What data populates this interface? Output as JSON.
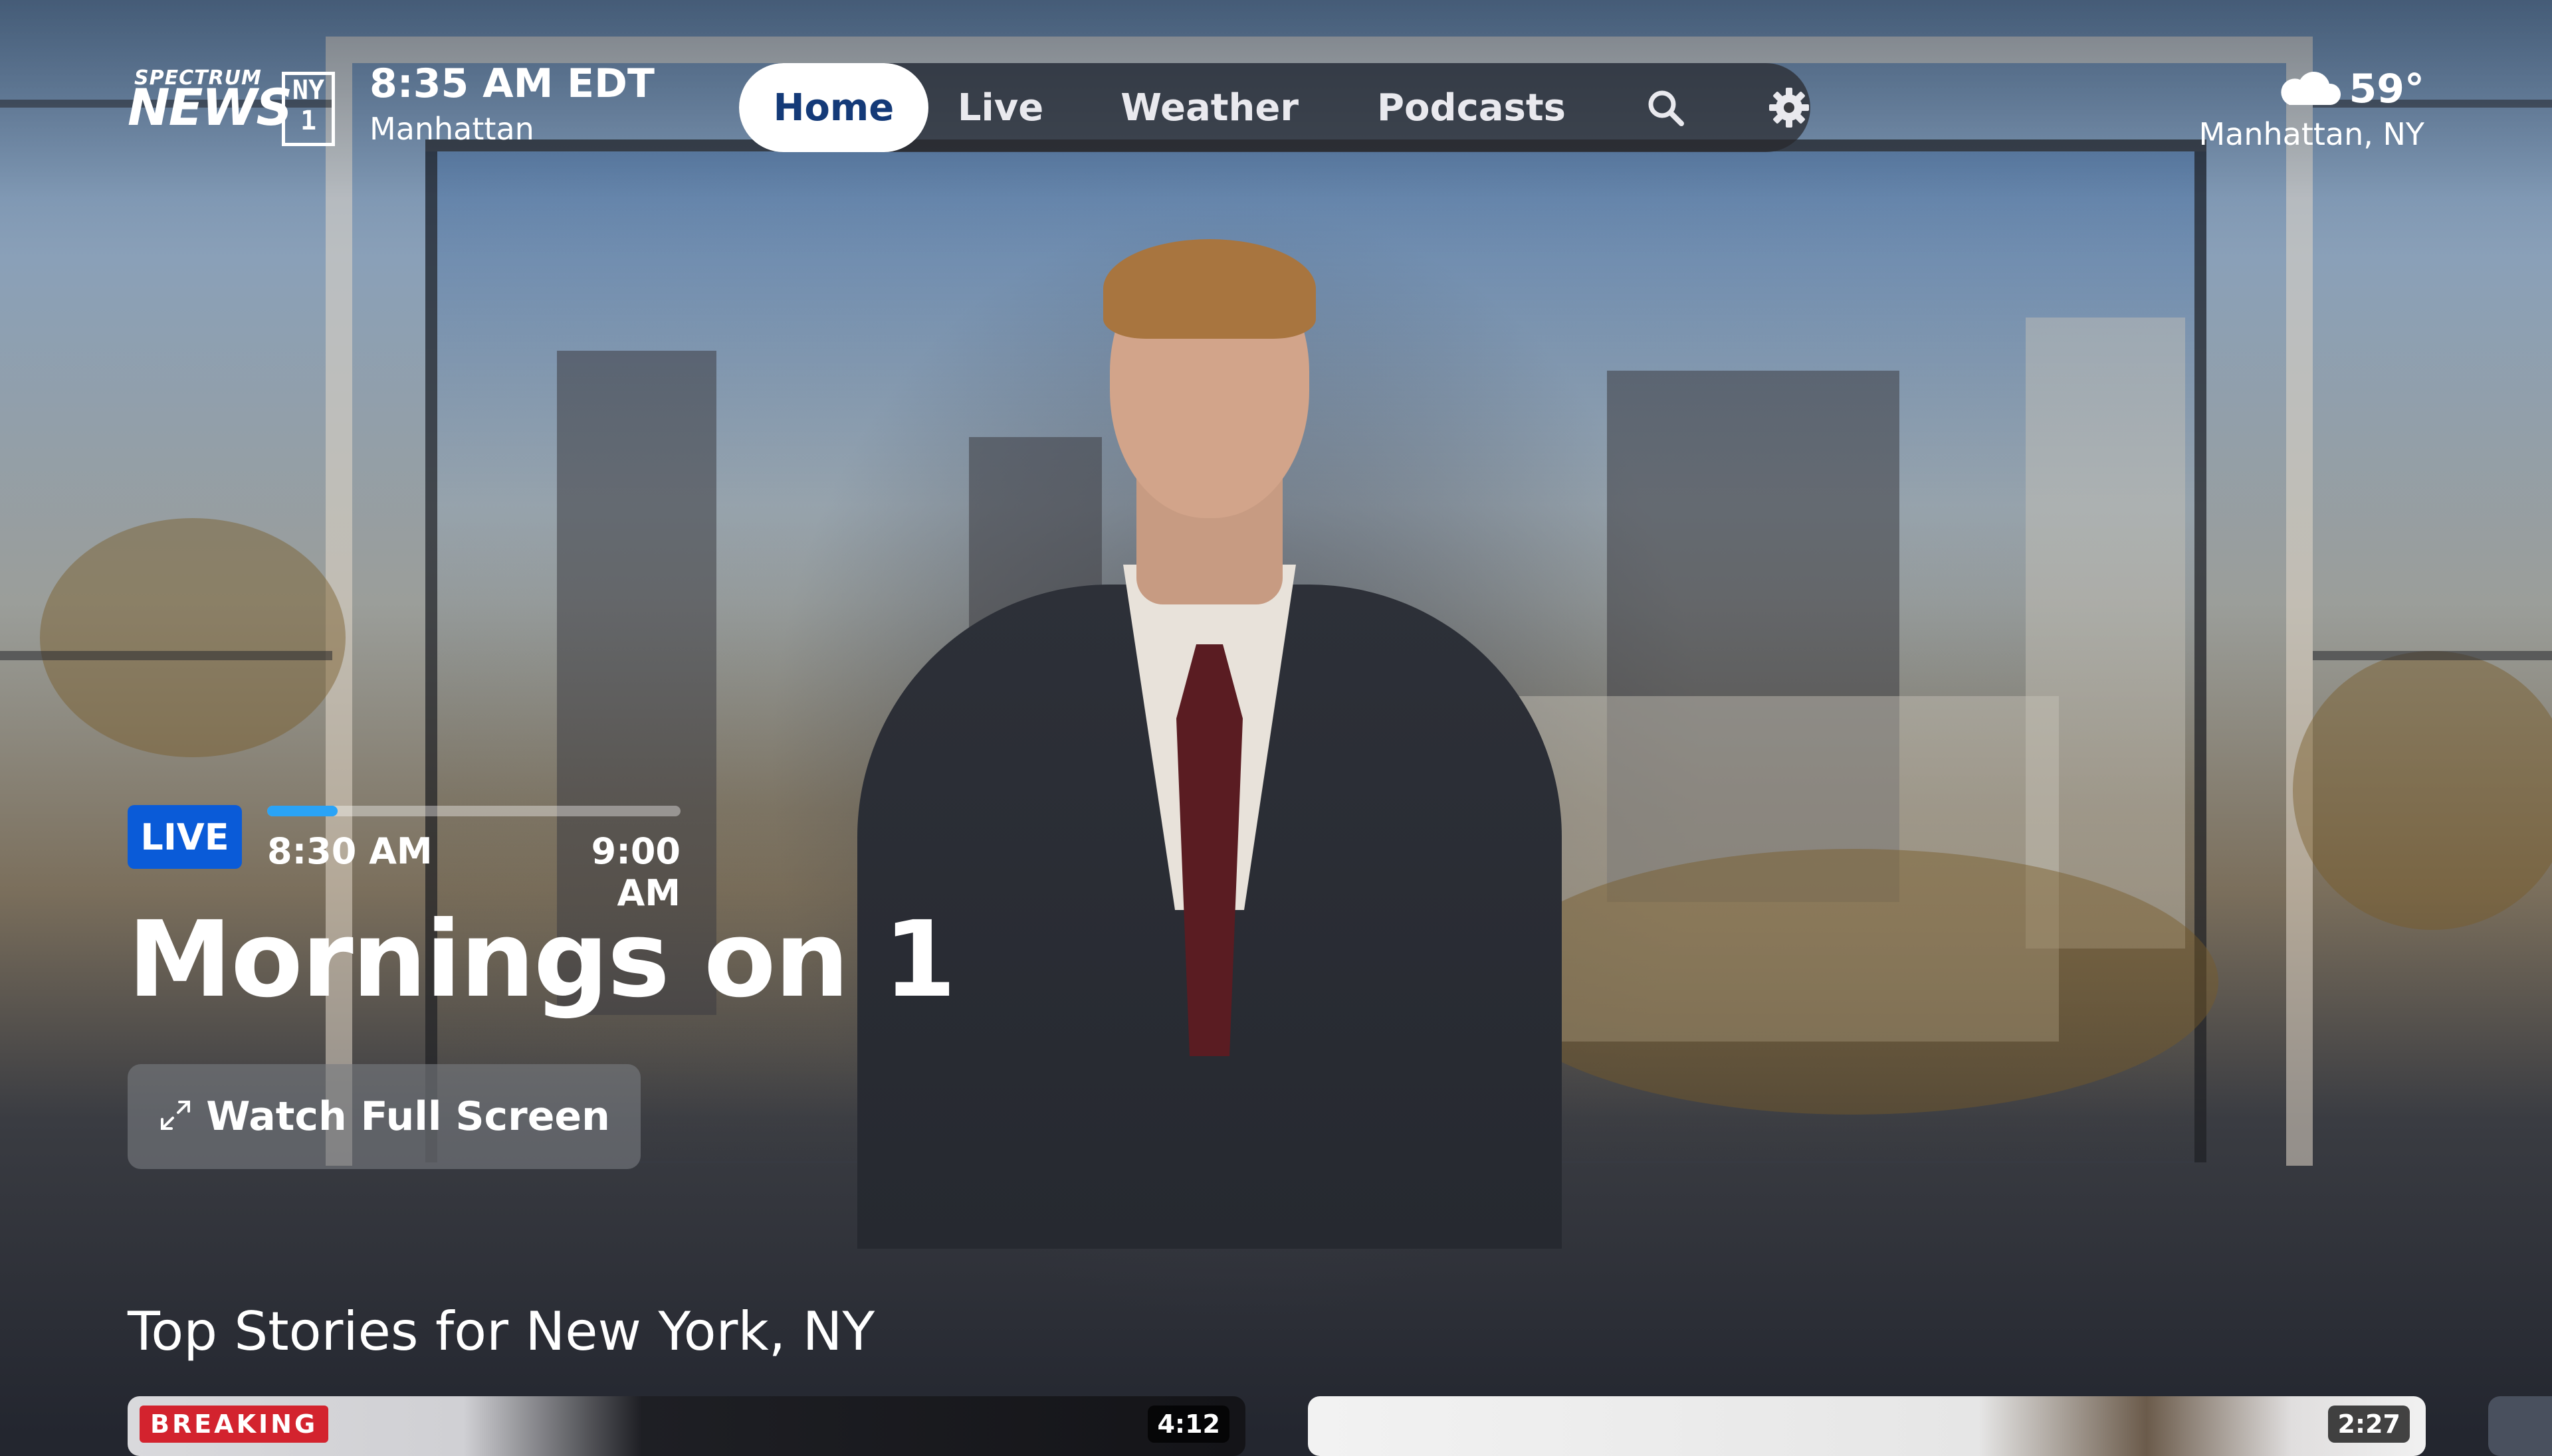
{
  "brand": {
    "logo_top": "SPECTRUM",
    "logo_main": "NEWS",
    "logo_badge": "NY1"
  },
  "header": {
    "time": "8:35 AM EDT",
    "location": "Manhattan"
  },
  "nav": {
    "items": [
      {
        "label": "Home",
        "selected": true
      },
      {
        "label": "Live"
      },
      {
        "label": "Weather"
      },
      {
        "label": "Podcasts"
      }
    ],
    "search_icon": "search-icon",
    "settings_icon": "gear-icon"
  },
  "weather": {
    "temperature": "59°",
    "location": "Manhattan, NY",
    "icon": "cloud-icon"
  },
  "live": {
    "badge": "LIVE",
    "start_time": "8:30 AM",
    "end_time": "9:00 AM",
    "progress_fraction": 0.17,
    "title": "Mornings on 1",
    "watch_button": "Watch Full Screen",
    "watch_icon": "expand-icon"
  },
  "stories": {
    "title": "Top Stories for New York, NY",
    "cards": [
      {
        "badge": "BREAKING",
        "duration": "4:12"
      },
      {
        "duration": "2:27"
      }
    ]
  },
  "colors": {
    "live_badge": "#0a5bd8",
    "progress": "#2aa3f6",
    "breaking": "#d3232e",
    "home_text": "#143a78"
  }
}
